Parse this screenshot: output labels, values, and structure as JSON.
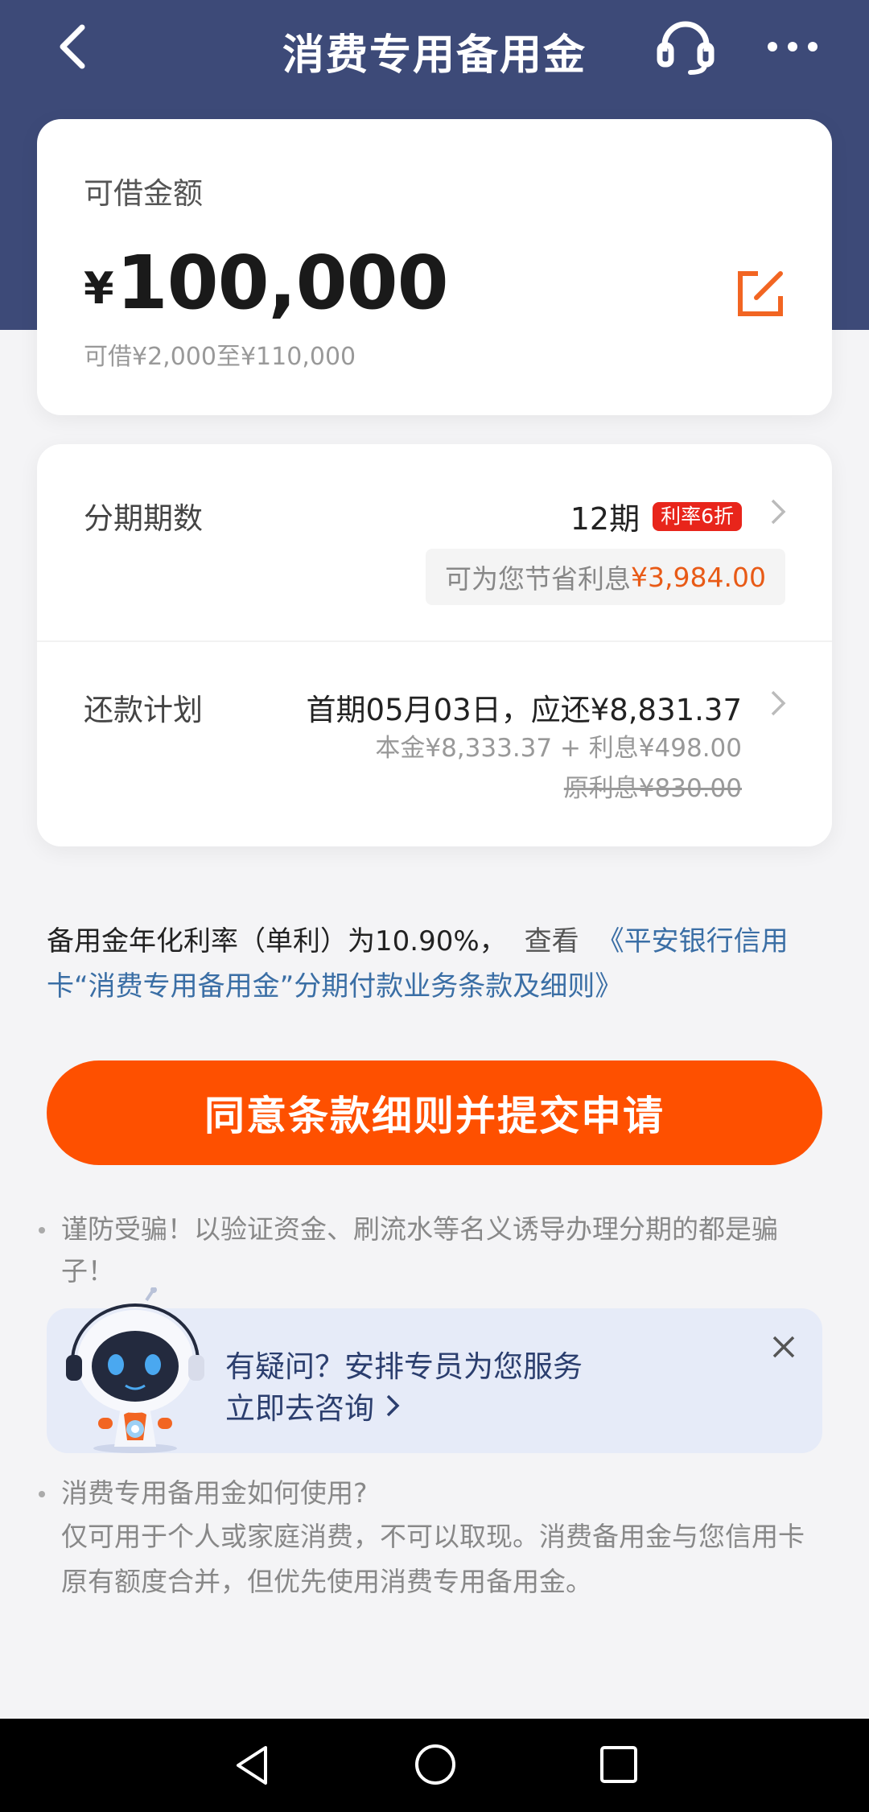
{
  "header": {
    "title": "消费专用备用金",
    "back_icon": "back-arrow-icon",
    "service_icon": "headset-icon",
    "more_icon": "more-dots-icon",
    "bg_color": "#3d4a78"
  },
  "amount_card": {
    "label": "可借金额",
    "currency": "¥",
    "amount": "100,000",
    "range": "可借¥2,000至¥110,000",
    "edit_icon": "edit-icon"
  },
  "installment": {
    "label": "分期期数",
    "value": "12期",
    "badge": "利率6折",
    "save_prefix": "可为您节省利息",
    "save_amount": "¥3,984.00"
  },
  "plan": {
    "label": "还款计划",
    "first": "首期05月03日，应还¥8,831.37",
    "detail": "本金¥8,333.37 + 利息¥498.00",
    "original": "原利息¥830.00"
  },
  "rate": {
    "text": "备用金年化利率（单利）为10.90%，",
    "see": "查看",
    "link": "《平安银行信用卡“消费专用备用金”分期付款业务条款及细则》"
  },
  "submit": {
    "label": "同意条款细则并提交申请",
    "color": "#fe5000"
  },
  "tips": {
    "tip1": "谨防受骗！以验证资金、刷流水等名义诱导办理分期的都是骗子！",
    "tip3_title": "消费专用备用金如何使用?",
    "tip3_body": "仅可用于个人或家庭消费，不可以取现。消费备用金与您信用卡原有额度合并，但优先使用消费专用备用金。"
  },
  "popup": {
    "line1": "有疑问？安排专员为您服务",
    "line2": "立即去咨询",
    "avatar_icon": "robot-avatar-icon",
    "close_icon": "close-icon"
  },
  "nav": {
    "back_icon": "nav-back-icon",
    "home_icon": "nav-home-icon",
    "recent_icon": "nav-recent-icon"
  }
}
